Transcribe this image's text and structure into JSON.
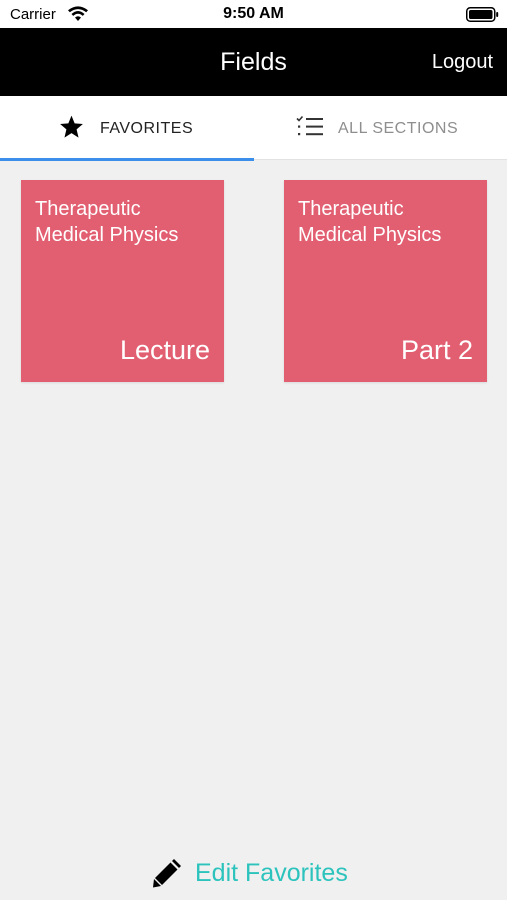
{
  "status_bar": {
    "carrier": "Carrier",
    "time": "9:50 AM",
    "wifi_icon": "wifi-icon",
    "battery_icon": "battery-icon"
  },
  "nav": {
    "title": "Fields",
    "logout_label": "Logout"
  },
  "tabs": [
    {
      "label": "FAVORITES",
      "icon": "star-icon",
      "active": true
    },
    {
      "label": "ALL SECTIONS",
      "icon": "checklist-icon",
      "active": false
    }
  ],
  "cards": [
    {
      "title": "Therapeutic Medical Physics",
      "subtitle": "Lecture"
    },
    {
      "title": "Therapeutic Medical Physics",
      "subtitle": "Part 2"
    }
  ],
  "edit_favorites": {
    "label": "Edit Favorites",
    "icon": "pencil-icon"
  },
  "colors": {
    "nav_background": "#000000",
    "card_background": "#e25f72",
    "tab_indicator": "#3b8eea",
    "edit_accent": "#2cc3bd",
    "page_background": "#f0f0f0"
  }
}
